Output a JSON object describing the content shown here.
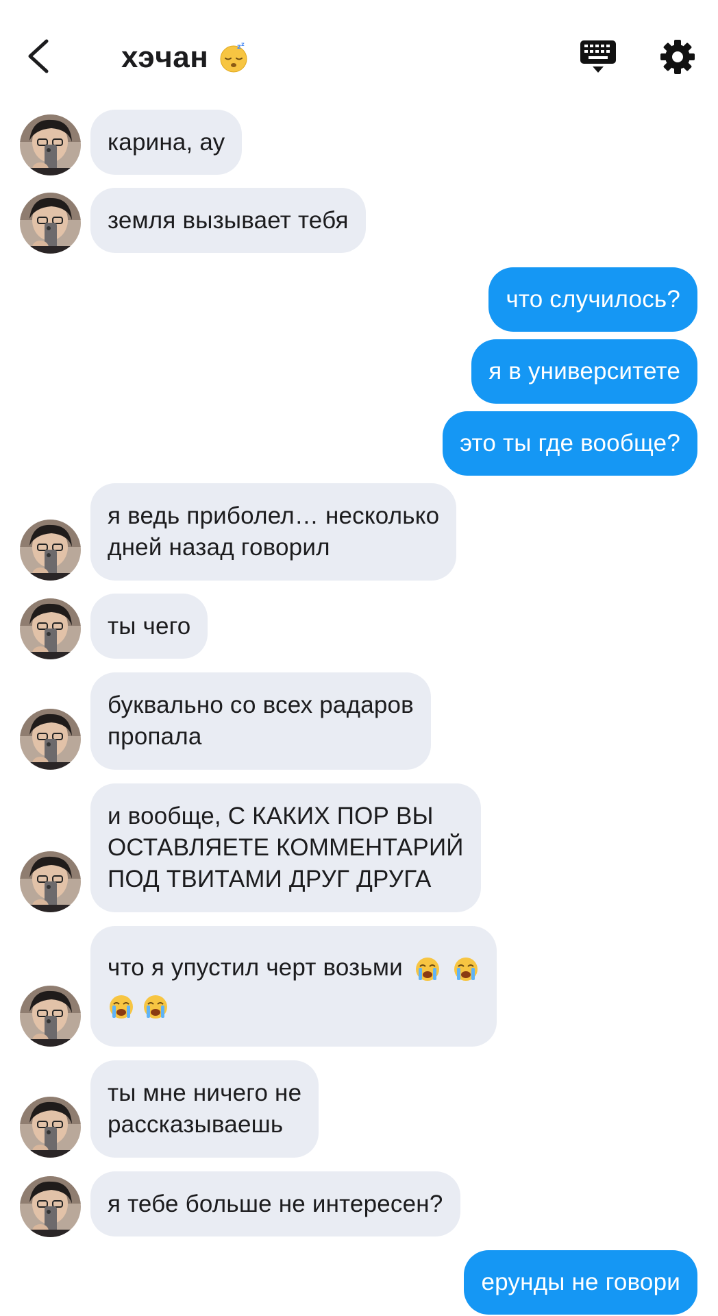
{
  "header": {
    "title": "хэчан",
    "title_emoji": "sleeping-face-emoji",
    "back_icon": "chevron-left-icon",
    "keyboard_icon": "keyboard-icon",
    "settings_icon": "gear-icon"
  },
  "colors": {
    "incoming_bubble": "#e9ecf3",
    "outgoing_bubble": "#1597f4",
    "text": "#1c1c1e",
    "background": "#ffffff"
  },
  "messages": [
    {
      "dir": "in",
      "text": "карина, ау"
    },
    {
      "dir": "in",
      "text": "земля вызывает тебя"
    },
    {
      "dir": "out",
      "text": "что случилось?"
    },
    {
      "dir": "out",
      "text": "я в университете"
    },
    {
      "dir": "out",
      "text": "это ты где вообще?"
    },
    {
      "dir": "in",
      "text": "я ведь приболел… несколько\nдней назад говорил"
    },
    {
      "dir": "in",
      "text": "ты чего"
    },
    {
      "dir": "in",
      "text": "буквально со всех радаров\nпропала"
    },
    {
      "dir": "in",
      "text": "и вообще, С КАКИХ ПОР ВЫ\nОСТАВЛЯЕТЕ КОММЕНТАРИЙ\nПОД ТВИТАМИ ДРУГ ДРУГА"
    },
    {
      "dir": "in",
      "text": "что я упустил черт возьми",
      "emoji": "loudly-crying-face-emoji"
    },
    {
      "dir": "in",
      "text": "ты мне ничего не\nрассказываешь"
    },
    {
      "dir": "in",
      "text": "я тебе больше не интересен?"
    },
    {
      "dir": "out",
      "text": "ерунды не говори"
    }
  ]
}
